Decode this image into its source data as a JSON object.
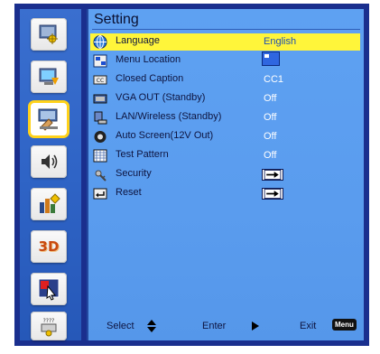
{
  "menu": {
    "title": "Setting",
    "sidebar_items": [
      {
        "icon": "picture-adjust-icon"
      },
      {
        "icon": "display-icon"
      },
      {
        "icon": "setting-icon",
        "active": true
      },
      {
        "icon": "volume-icon"
      },
      {
        "icon": "options-icon"
      },
      {
        "icon": "3d-icon",
        "text": "3D"
      },
      {
        "icon": "interactive-icon"
      },
      {
        "icon": "lan-icon",
        "text": "????"
      }
    ],
    "rows": [
      {
        "label": "Language",
        "value": "English",
        "icon": "language-globe-icon",
        "selected": true
      },
      {
        "label": "Menu Location",
        "value": "",
        "icon": "menu-location-icon",
        "value_type": "screen"
      },
      {
        "label": "Closed Caption",
        "value": "CC1",
        "icon": "closed-caption-icon"
      },
      {
        "label": "VGA OUT (Standby)",
        "value": "Off",
        "icon": "vga-out-icon"
      },
      {
        "label": "LAN/Wireless (Standby)",
        "value": "Off",
        "icon": "lan-wireless-icon"
      },
      {
        "label": "Auto Screen(12V Out)",
        "value": "Off",
        "icon": "auto-screen-icon"
      },
      {
        "label": "Test Pattern",
        "value": "Off",
        "icon": "test-pattern-icon"
      },
      {
        "label": "Security",
        "value": "",
        "icon": "security-icon",
        "value_type": "arrow"
      },
      {
        "label": "Reset",
        "value": "",
        "icon": "reset-icon",
        "value_type": "arrow"
      }
    ],
    "footer": {
      "select_label": "Select",
      "enter_label": "Enter",
      "exit_label": "Exit",
      "menu_key": "Menu"
    },
    "colors": {
      "frame": "#1a2f8e",
      "sidebar": "#2f64c6",
      "panel": "#5a9cee",
      "highlight": "#fff53a",
      "active_border": "#ffd21a"
    }
  }
}
